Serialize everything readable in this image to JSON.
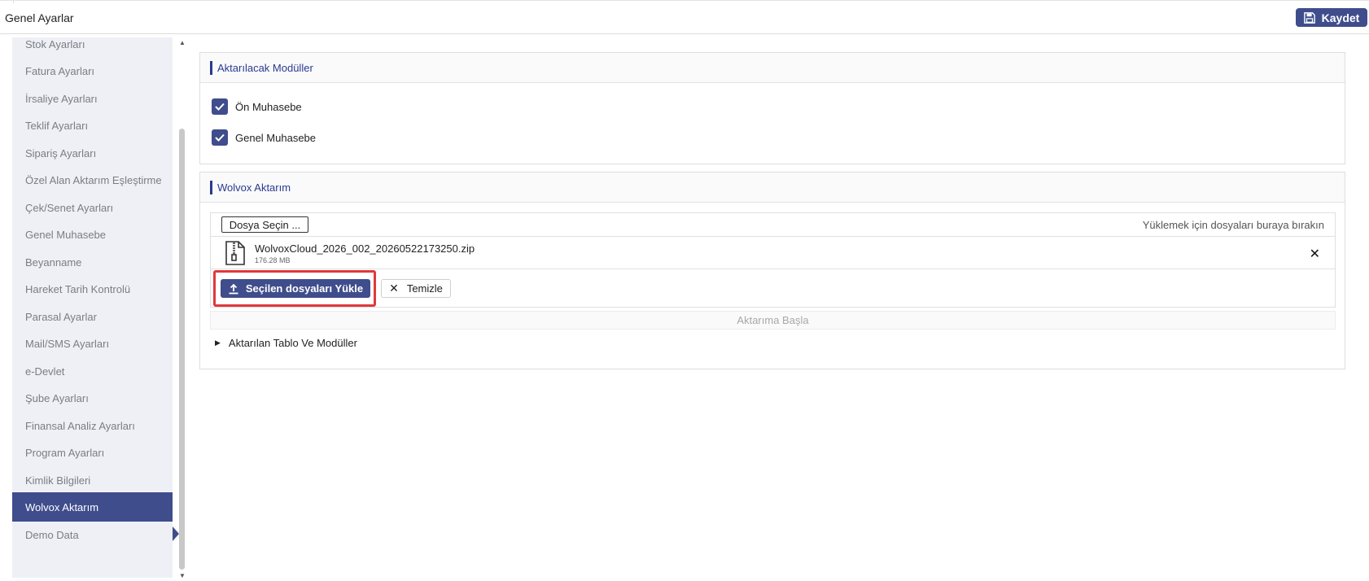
{
  "header": {
    "title": "Genel Ayarlar",
    "save_label": "Kaydet"
  },
  "sidebar": {
    "items": [
      {
        "label": "Stok Ayarları"
      },
      {
        "label": "Fatura Ayarları"
      },
      {
        "label": "İrsaliye Ayarları"
      },
      {
        "label": "Teklif Ayarları"
      },
      {
        "label": "Sipariş Ayarları"
      },
      {
        "label": "Özel Alan Aktarım Eşleştirme"
      },
      {
        "label": "Çek/Senet Ayarları"
      },
      {
        "label": "Genel Muhasebe"
      },
      {
        "label": "Beyanname"
      },
      {
        "label": "Hareket Tarih Kontrolü"
      },
      {
        "label": "Parasal Ayarlar"
      },
      {
        "label": "Mail/SMS Ayarları"
      },
      {
        "label": "e-Devlet"
      },
      {
        "label": "Şube Ayarları"
      },
      {
        "label": "Finansal Analiz Ayarları"
      },
      {
        "label": "Program Ayarları"
      },
      {
        "label": "Kimlik Bilgileri"
      },
      {
        "label": "Wolvox Aktarım"
      },
      {
        "label": "Demo Data"
      }
    ],
    "active": "Wolvox Aktarım"
  },
  "modules_panel": {
    "title": "Aktarılacak Modüller",
    "items": [
      {
        "label": "Ön Muhasebe",
        "checked": true
      },
      {
        "label": "Genel Muhasebe",
        "checked": true
      }
    ]
  },
  "wolvox_panel": {
    "title": "Wolvox Aktarım",
    "choose_label": "Dosya Seçin ...",
    "drop_hint": "Yüklemek için dosyaları buraya bırakın",
    "file": {
      "name": "WolvoxCloud_2026_002_20260522173250.zip",
      "size": "176.28 MB"
    },
    "upload_label": "Seçilen dosyaları Yükle",
    "clear_label": "Temizle",
    "start_label": "Aktarıma Başla",
    "tree_label": "Aktarılan Tablo Ve Modüller"
  },
  "colors": {
    "accent": "#3f4d8c",
    "title_blue": "#2a3a8f",
    "highlight": "#e0383b"
  },
  "icons": {
    "save": "floppy-disk-icon",
    "check": "checkmark-icon",
    "file": "zip-file-icon",
    "remove": "close-icon",
    "upload": "upload-icon",
    "clear": "x-icon",
    "caret": "caret-right-icon"
  }
}
